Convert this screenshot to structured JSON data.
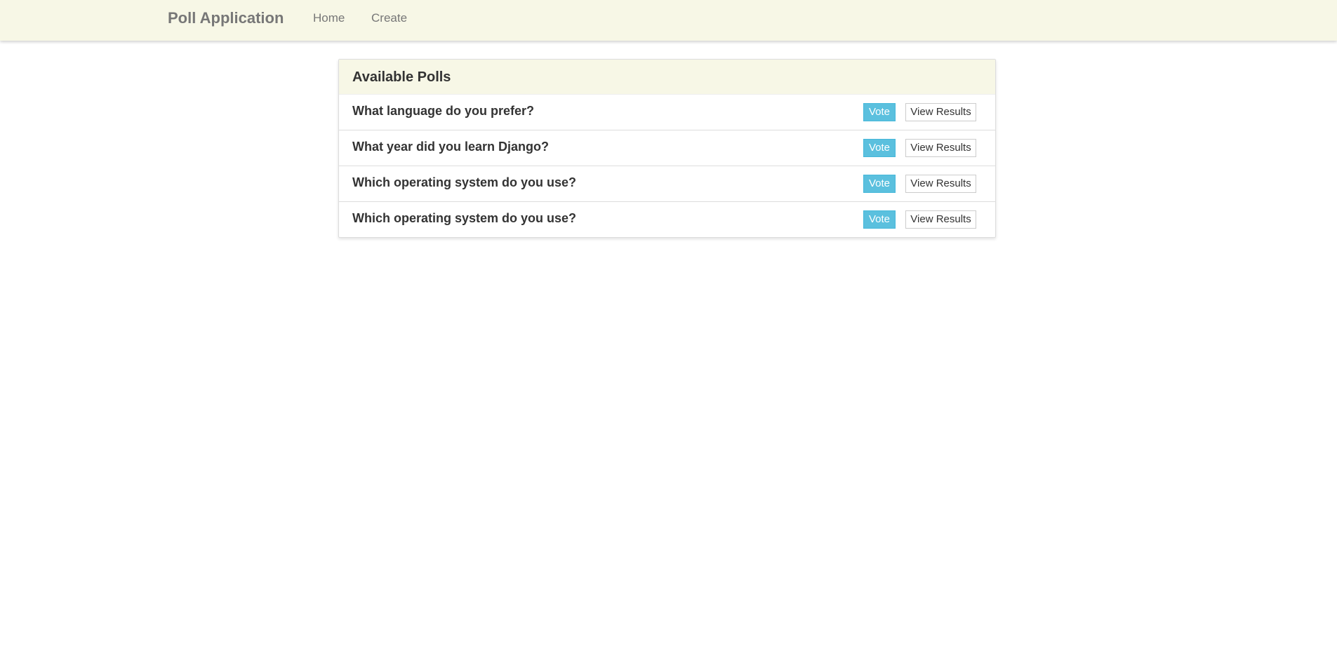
{
  "navbar": {
    "brand": "Poll Application",
    "links": [
      {
        "label": "Home"
      },
      {
        "label": "Create"
      }
    ]
  },
  "panel": {
    "title": "Available Polls",
    "polls": [
      {
        "question": "What language do you prefer?",
        "vote_label": "Vote",
        "results_label": "View Results"
      },
      {
        "question": "What year did you learn Django?",
        "vote_label": "Vote",
        "results_label": "View Results"
      },
      {
        "question": "Which operating system do you use?",
        "vote_label": "Vote",
        "results_label": "View Results"
      },
      {
        "question": "Which operating system do you use?",
        "vote_label": "Vote",
        "results_label": "View Results"
      }
    ]
  },
  "colors": {
    "navbar_bg": "#f7f7e6",
    "vote_button": "#5bc0de"
  }
}
